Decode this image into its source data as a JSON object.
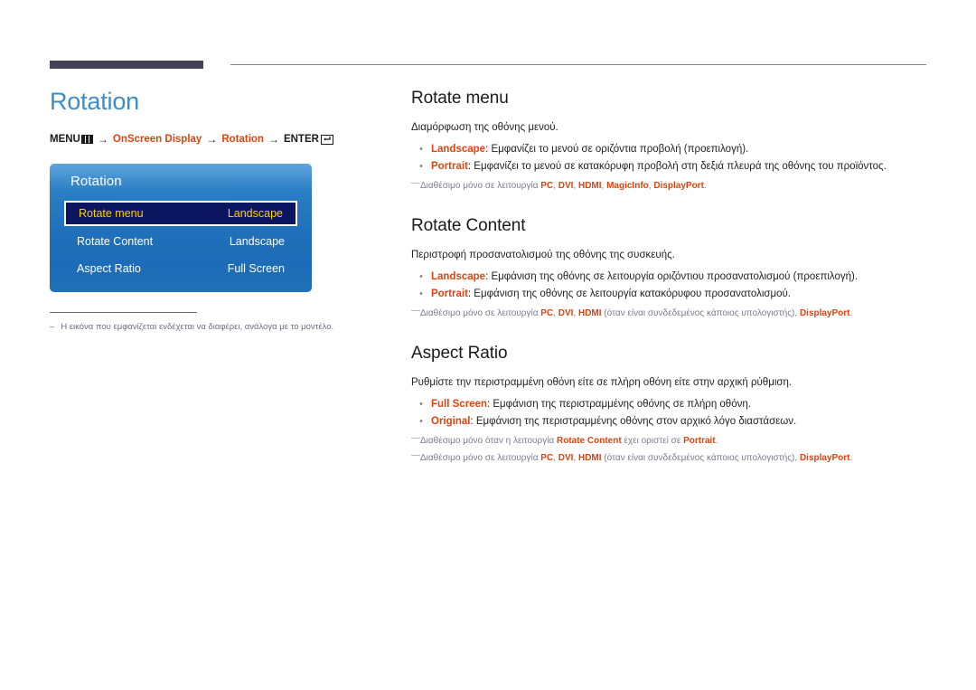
{
  "header": {
    "thick_bar_color": "#453f57",
    "thin_rule_color": "#808080"
  },
  "left": {
    "page_title": "Rotation",
    "breadcrumb": {
      "menu_label": "MENU",
      "menu_icon": "menu-bars-icon",
      "arrow1": "→",
      "item1": "OnScreen Display",
      "arrow2": "→",
      "item2": "Rotation",
      "arrow3": "→",
      "enter_label": "ENTER",
      "enter_icon": "enter-return-icon",
      "accent_color": "#e0430d"
    },
    "osd": {
      "title": "Rotation",
      "rows": [
        {
          "label": "Rotate menu",
          "value": "Landscape",
          "selected": true
        },
        {
          "label": "Rotate Content",
          "value": "Landscape",
          "selected": false
        },
        {
          "label": "Aspect Ratio",
          "value": "Full Screen",
          "selected": false
        }
      ],
      "bg_top_color": "#5fa4dd",
      "bg_bottom_color": "#2070b9",
      "selected_bg_color": "#0b1560",
      "selected_text_color": "#ffd000"
    },
    "footnote": {
      "dash": "–",
      "text": "Η εικόνα που εμφανίζεται ενδέχεται να διαφέρει, ανάλογα με το μοντέλο."
    }
  },
  "right": {
    "sections": [
      {
        "title": "Rotate menu",
        "intro": "Διαμόρφωση της οθόνης μενού.",
        "bullets": [
          {
            "kw": "Landscape",
            "rest": ": Εμφανίζει το μενού σε οριζόντια προβολή (προεπιλογή)."
          },
          {
            "kw": "Portrait",
            "rest": ": Εμφανίζει το μενού σε κατακόρυφη προβολή στη δεξιά πλευρά της οθόνης του προϊόντος."
          }
        ],
        "notes": [
          {
            "parts": [
              {
                "t": "Διαθέσιμο μόνο σε λειτουργία ",
                "kw": false
              },
              {
                "t": "PC",
                "kw": true
              },
              {
                "t": ", ",
                "kw": false
              },
              {
                "t": "DVI",
                "kw": true
              },
              {
                "t": ", ",
                "kw": false
              },
              {
                "t": "HDMI",
                "kw": true
              },
              {
                "t": ", ",
                "kw": false
              },
              {
                "t": "MagicInfo",
                "kw": true
              },
              {
                "t": ", ",
                "kw": false
              },
              {
                "t": "DisplayPort",
                "kw": true
              },
              {
                "t": ".",
                "kw": false
              }
            ]
          }
        ]
      },
      {
        "title": "Rotate Content",
        "intro": "Περιστροφή προσανατολισμού της οθόνης της συσκευής.",
        "bullets": [
          {
            "kw": "Landscape",
            "rest": ": Εμφάνιση της οθόνης σε λειτουργία οριζόντιου προσανατολισμού (προεπιλογή)."
          },
          {
            "kw": "Portrait",
            "rest": ": Εμφάνιση της οθόνης σε λειτουργία κατακόρυφου προσανατολισμού."
          }
        ],
        "notes": [
          {
            "parts": [
              {
                "t": "Διαθέσιμο μόνο σε λειτουργία ",
                "kw": false
              },
              {
                "t": "PC",
                "kw": true
              },
              {
                "t": ", ",
                "kw": false
              },
              {
                "t": "DVI",
                "kw": true
              },
              {
                "t": ", ",
                "kw": false
              },
              {
                "t": "HDMI",
                "kw": true
              },
              {
                "t": " (όταν είναι συνδεδεμένος κάποιος υπολογιστής), ",
                "kw": false
              },
              {
                "t": "DisplayPort",
                "kw": true
              },
              {
                "t": ".",
                "kw": false
              }
            ]
          }
        ]
      },
      {
        "title": "Aspect Ratio",
        "intro": "Ρυθμίστε την περιστραμμένη οθόνη είτε σε πλήρη οθόνη είτε στην αρχική ρύθμιση.",
        "bullets": [
          {
            "kw": "Full Screen",
            "rest": ": Εμφάνιση της περιστραμμένης οθόνης σε πλήρη οθόνη."
          },
          {
            "kw": "Original",
            "rest": ": Εμφάνιση της περιστραμμένης οθόνης στον αρχικό λόγο διαστάσεων."
          }
        ],
        "notes": [
          {
            "parts": [
              {
                "t": "Διαθέσιμο μόνο όταν η λειτουργία ",
                "kw": false
              },
              {
                "t": "Rotate Content",
                "kw": true
              },
              {
                "t": " έχει οριστεί σε ",
                "kw": false
              },
              {
                "t": "Portrait",
                "kw": true
              },
              {
                "t": ".",
                "kw": false
              }
            ]
          },
          {
            "parts": [
              {
                "t": "Διαθέσιμο μόνο σε λειτουργία ",
                "kw": false
              },
              {
                "t": "PC",
                "kw": true
              },
              {
                "t": ", ",
                "kw": false
              },
              {
                "t": "DVI",
                "kw": true
              },
              {
                "t": ", ",
                "kw": false
              },
              {
                "t": "HDMI",
                "kw": true
              },
              {
                "t": " (όταν είναι συνδεδεμένος κάποιος υπολογιστής), ",
                "kw": false
              },
              {
                "t": "DisplayPort",
                "kw": true
              },
              {
                "t": ".",
                "kw": false
              }
            ]
          }
        ]
      }
    ]
  }
}
